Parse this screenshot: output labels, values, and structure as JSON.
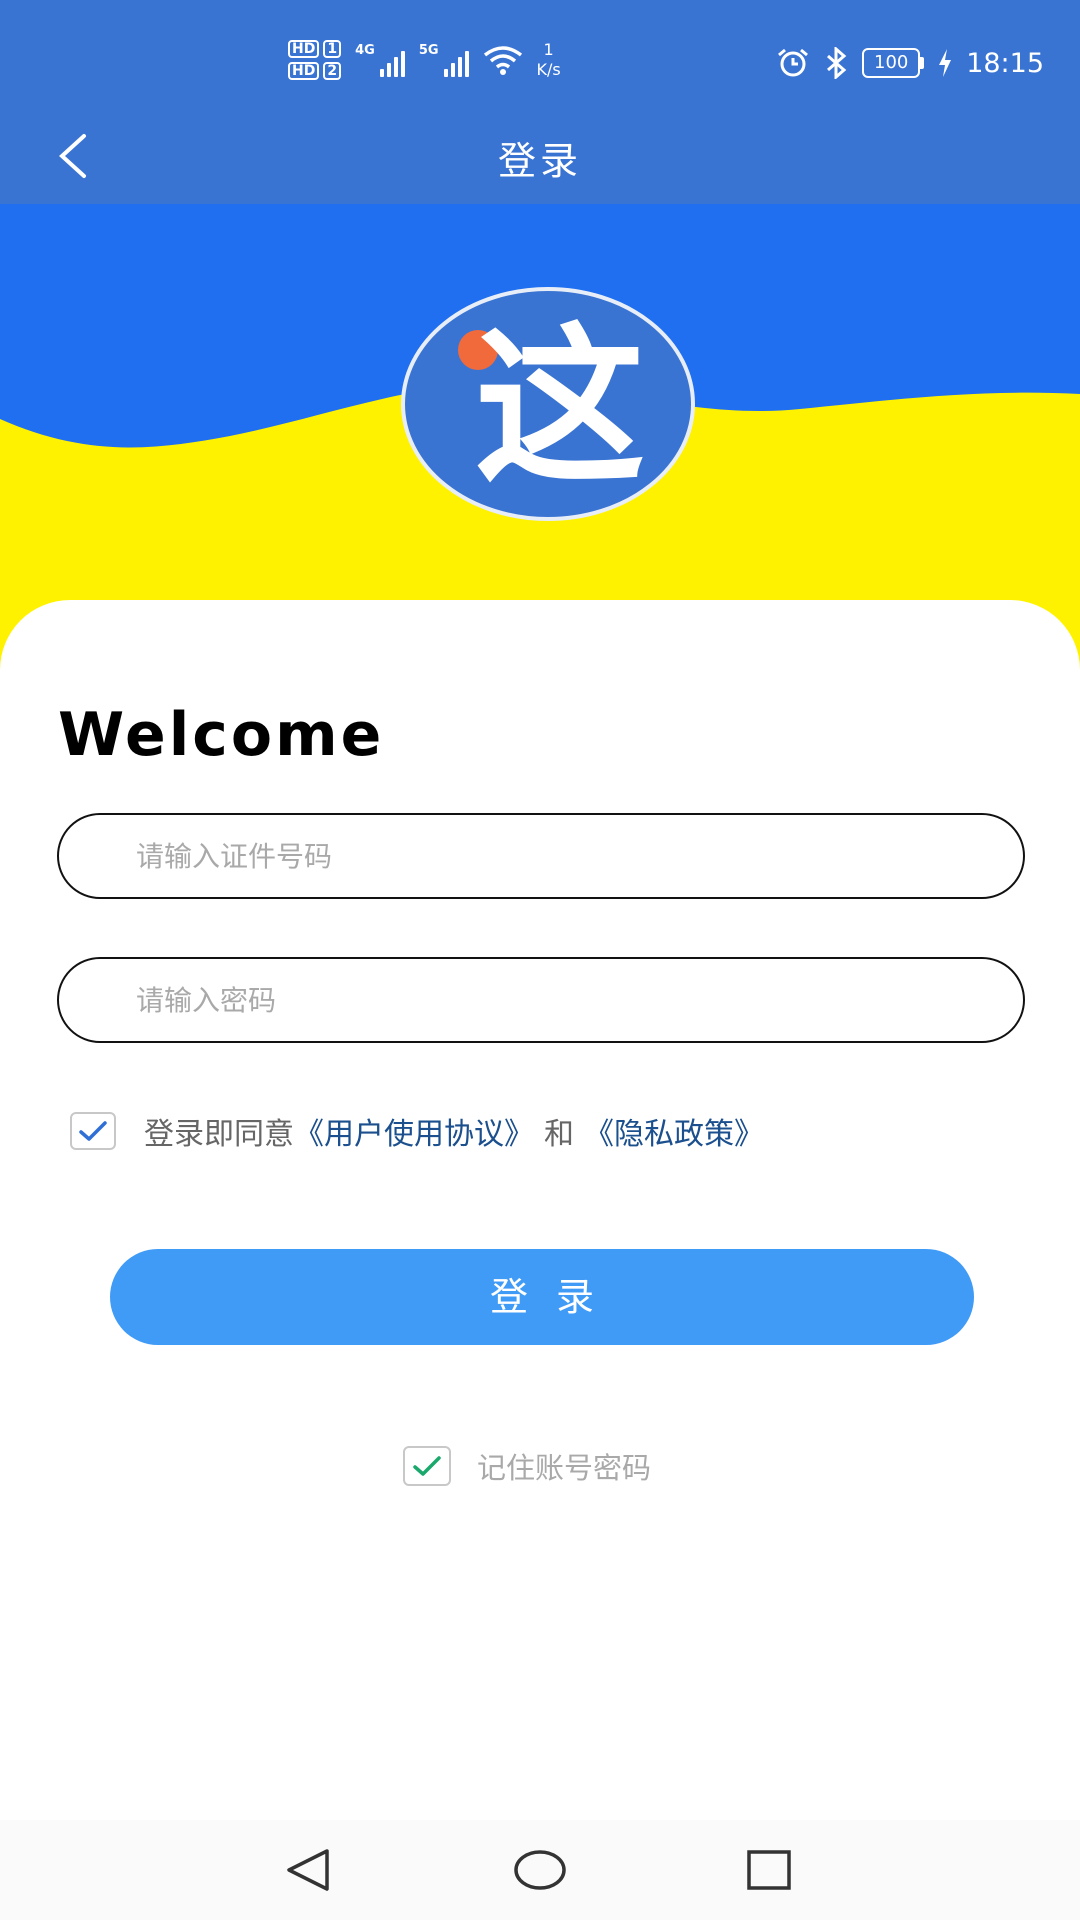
{
  "status_bar": {
    "sim1": "HD",
    "sim1_index": "1",
    "sim2": "HD",
    "sim2_index": "2",
    "network1": "4G",
    "network2": "5G",
    "speed_value": "1",
    "speed_unit": "K/s",
    "battery": "100",
    "time": "18:15"
  },
  "header": {
    "title": "登录"
  },
  "logo": {
    "glyph": "这"
  },
  "main": {
    "welcome": "Welcome",
    "id_placeholder": "请输入证件号码",
    "password_placeholder": "请输入密码",
    "agreement_prefix": "登录即同意",
    "user_agreement_link": "《用户使用协议》",
    "agreement_and": "和",
    "privacy_link": "《隐私政策》",
    "agreement_checked": true,
    "login_button": "登录",
    "remember_label": "记住账号密码",
    "remember_checked": true
  },
  "colors": {
    "header_bg": "#3a74d3",
    "banner_blue": "#1f6ff0",
    "banner_yellow": "#fff200",
    "logo_blue": "#3a74d3",
    "logo_dot": "#f06a3c",
    "button": "#409bf7",
    "link": "#1b4f8d",
    "check_blue": "#2f6fd6",
    "check_green": "#1aa86c"
  }
}
